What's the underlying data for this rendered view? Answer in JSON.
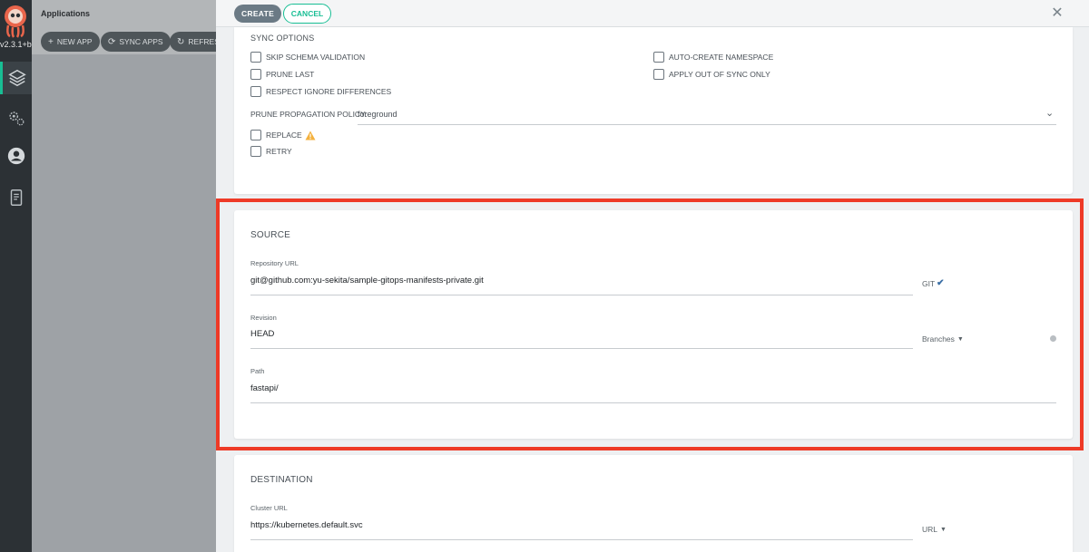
{
  "rail": {
    "version": "v2.3.1+b",
    "nav": [
      "applications-icon",
      "settings-icon",
      "user-icon",
      "docs-icon"
    ]
  },
  "behind": {
    "title": "Applications",
    "buttons": [
      {
        "icon": "+",
        "label": "NEW APP"
      },
      {
        "icon": "⟳",
        "label": "SYNC APPS"
      },
      {
        "icon": "↻",
        "label": "REFRESH"
      }
    ]
  },
  "panel": {
    "create_label": "CREATE",
    "cancel_label": "CANCEL",
    "close_label": "✕"
  },
  "sync": {
    "title": "SYNC OPTIONS",
    "left_options": [
      "SKIP SCHEMA VALIDATION",
      "PRUNE LAST",
      "RESPECT IGNORE DIFFERENCES"
    ],
    "right_options": [
      "AUTO-CREATE NAMESPACE",
      "APPLY OUT OF SYNC ONLY"
    ],
    "prune_policy_label": "PRUNE PROPAGATION POLICY:",
    "prune_policy_value": "foreground",
    "extra_options": [
      "REPLACE",
      "RETRY"
    ]
  },
  "source": {
    "title": "SOURCE",
    "repo_label": "Repository URL",
    "repo_value": "git@github.com:yu-sekita/sample-gitops-manifests-private.git",
    "repo_type": "GIT",
    "revision_label": "Revision",
    "revision_value": "HEAD",
    "revision_type": "Branches",
    "path_label": "Path",
    "path_value": "fastapi/"
  },
  "destination": {
    "title": "DESTINATION",
    "cluster_label": "Cluster URL",
    "cluster_value": "https://kubernetes.default.svc",
    "cluster_type": "URL"
  },
  "colors": {
    "accent": "#18be94",
    "highlight": "#ee3a27",
    "rail": "#2c3135"
  }
}
